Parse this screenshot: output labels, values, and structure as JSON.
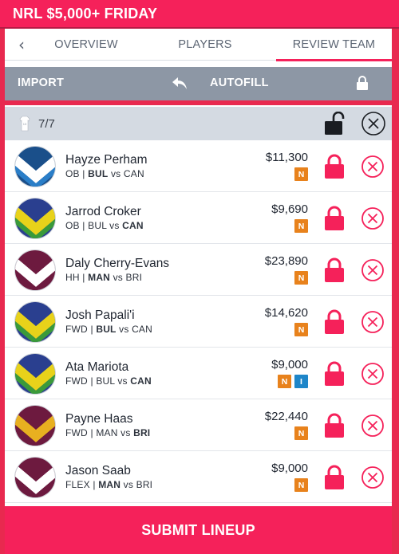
{
  "header": {
    "title": "NRL $5,000+ FRIDAY"
  },
  "tabs": [
    "OVERVIEW",
    "PLAYERS",
    "REVIEW TEAM"
  ],
  "toolbar": {
    "import_label": "IMPORT",
    "autofill_label": "AUTOFILL"
  },
  "lineup": {
    "count": "7/7",
    "jersey_number": "13"
  },
  "colors": {
    "accent": "#f5215a",
    "toolbar": "#8d97a5",
    "badge_n": "#e8821c",
    "badge_i": "#1e86c9"
  },
  "players": [
    {
      "name": "Hayze Perham",
      "position": "OB",
      "team": "BUL",
      "opp": "CAN",
      "bold": "team",
      "price": "$11,300",
      "badges": [
        "N"
      ],
      "jersey": [
        "#1a4f8a",
        "#ffffff",
        "#2a7ec8"
      ]
    },
    {
      "name": "Jarrod Croker",
      "position": "OB",
      "team": "BUL",
      "opp": "CAN",
      "bold": "opp",
      "price": "$9,690",
      "badges": [
        "N"
      ],
      "jersey": [
        "#2a3f8f",
        "#e8d21a",
        "#3a9a3a"
      ]
    },
    {
      "name": "Daly Cherry-Evans",
      "position": "HH",
      "team": "MAN",
      "opp": "BRI",
      "bold": "team",
      "price": "$23,890",
      "badges": [
        "N"
      ],
      "jersey": [
        "#6d1a3f",
        "#ffffff",
        "#6d1a3f"
      ]
    },
    {
      "name": "Josh Papali'i",
      "position": "FWD",
      "team": "BUL",
      "opp": "CAN",
      "bold": "team",
      "price": "$14,620",
      "badges": [
        "N"
      ],
      "jersey": [
        "#2a3f8f",
        "#e8d21a",
        "#3a9a3a"
      ]
    },
    {
      "name": "Ata Mariota",
      "position": "FWD",
      "team": "BUL",
      "opp": "CAN",
      "bold": "opp",
      "price": "$9,000",
      "badges": [
        "N",
        "I"
      ],
      "jersey": [
        "#2a3f8f",
        "#e8d21a",
        "#3a9a3a"
      ]
    },
    {
      "name": "Payne Haas",
      "position": "FWD",
      "team": "MAN",
      "opp": "BRI",
      "bold": "opp",
      "price": "$22,440",
      "badges": [
        "N"
      ],
      "jersey": [
        "#6d1a3f",
        "#e8b020",
        "#6d1a3f"
      ]
    },
    {
      "name": "Jason Saab",
      "position": "FLEX",
      "team": "MAN",
      "opp": "BRI",
      "bold": "team",
      "price": "$9,000",
      "badges": [
        "N"
      ],
      "jersey": [
        "#6d1a3f",
        "#ffffff",
        "#6d1a3f"
      ]
    }
  ],
  "submit": {
    "label": "SUBMIT LINEUP"
  }
}
